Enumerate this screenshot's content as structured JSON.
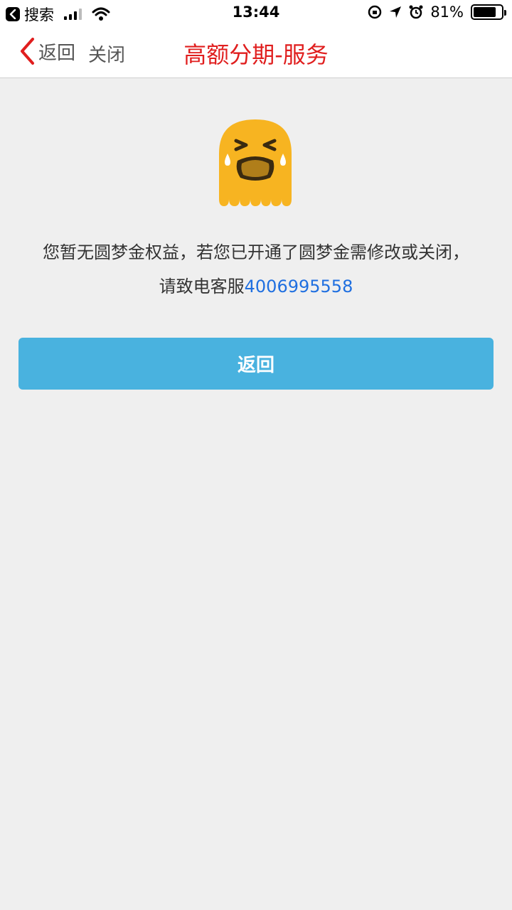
{
  "status_bar": {
    "back_app_label": "搜索",
    "time": "13:44",
    "battery_percent": "81%",
    "battery_level": 0.81
  },
  "nav": {
    "back_label": "返回",
    "close_label": "关闭",
    "title": "高额分期-服务",
    "title_color": "#e01e1e"
  },
  "content": {
    "message_line1": "您暂无圆梦金权益，若您已开通了圆梦金需修改或关闭，",
    "message_line2_prefix": "请致电客服",
    "phone": "4006995558",
    "button_label": "返回",
    "button_color": "#49b2df",
    "icon": "crying-ghost-icon"
  }
}
